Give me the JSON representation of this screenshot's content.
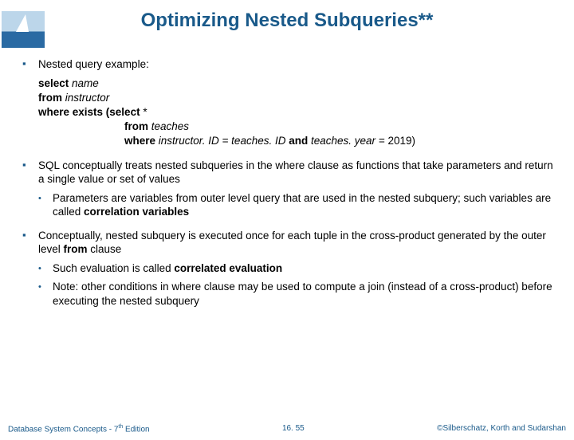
{
  "title": "Optimizing Nested Subqueries**",
  "bullets": {
    "b1": "Nested query example:",
    "code": {
      "l1a": "select",
      "l1b": " name",
      "l2a": "from",
      "l2b": " instructor",
      "l3a": "where exists (select ",
      "l3b": "*",
      "l4a": "from",
      "l4b": " teaches",
      "l5a": "where",
      "l5b": " instructor. ID = teaches. ID ",
      "l5c": "and",
      "l5d": " teaches. year = ",
      "l5e": "2019)"
    },
    "b2": "SQL conceptually treats nested subqueries in the where clause as        functions that take parameters and return a single value or set of values",
    "b2s1a": "Parameters are variables from outer level query that are used in the  nested subquery; such variables are called ",
    "b2s1b": "correlation variables",
    "b3a": "Conceptually, nested subquery is executed once for each tuple in the        cross-product generated by the outer level ",
    "b3b": "from",
    "b3c": " clause",
    "b3s1a": "Such evaluation is called ",
    "b3s1b": "correlated evaluation",
    "b3s2": "Note: other conditions in where clause may be used to compute a join (instead of a cross-product) before executing the nested subquery"
  },
  "footer": {
    "left": "Database System Concepts - 7",
    "left_sup": "th",
    "left2": " Edition",
    "center": "16. 55",
    "right": "©Silberschatz, Korth and Sudarshan"
  }
}
